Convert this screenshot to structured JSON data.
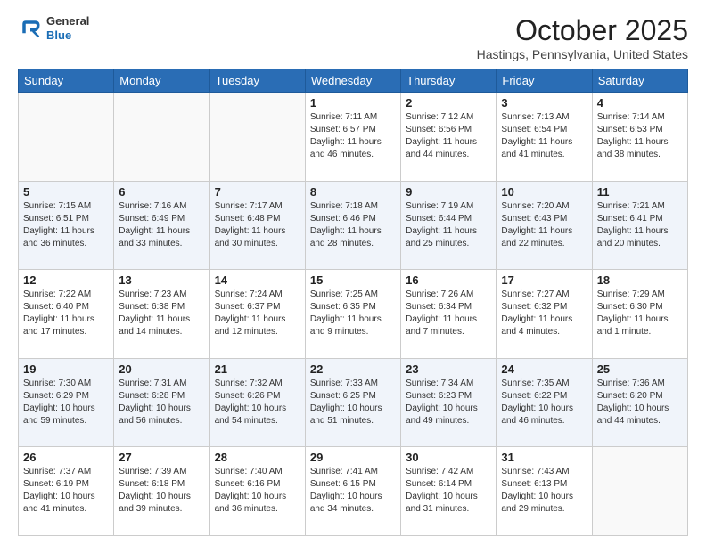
{
  "header": {
    "logo_line1": "General",
    "logo_line2": "Blue",
    "month": "October 2025",
    "location": "Hastings, Pennsylvania, United States"
  },
  "weekdays": [
    "Sunday",
    "Monday",
    "Tuesday",
    "Wednesday",
    "Thursday",
    "Friday",
    "Saturday"
  ],
  "weeks": [
    [
      {
        "day": "",
        "info": ""
      },
      {
        "day": "",
        "info": ""
      },
      {
        "day": "",
        "info": ""
      },
      {
        "day": "1",
        "info": "Sunrise: 7:11 AM\nSunset: 6:57 PM\nDaylight: 11 hours and 46 minutes."
      },
      {
        "day": "2",
        "info": "Sunrise: 7:12 AM\nSunset: 6:56 PM\nDaylight: 11 hours and 44 minutes."
      },
      {
        "day": "3",
        "info": "Sunrise: 7:13 AM\nSunset: 6:54 PM\nDaylight: 11 hours and 41 minutes."
      },
      {
        "day": "4",
        "info": "Sunrise: 7:14 AM\nSunset: 6:53 PM\nDaylight: 11 hours and 38 minutes."
      }
    ],
    [
      {
        "day": "5",
        "info": "Sunrise: 7:15 AM\nSunset: 6:51 PM\nDaylight: 11 hours and 36 minutes."
      },
      {
        "day": "6",
        "info": "Sunrise: 7:16 AM\nSunset: 6:49 PM\nDaylight: 11 hours and 33 minutes."
      },
      {
        "day": "7",
        "info": "Sunrise: 7:17 AM\nSunset: 6:48 PM\nDaylight: 11 hours and 30 minutes."
      },
      {
        "day": "8",
        "info": "Sunrise: 7:18 AM\nSunset: 6:46 PM\nDaylight: 11 hours and 28 minutes."
      },
      {
        "day": "9",
        "info": "Sunrise: 7:19 AM\nSunset: 6:44 PM\nDaylight: 11 hours and 25 minutes."
      },
      {
        "day": "10",
        "info": "Sunrise: 7:20 AM\nSunset: 6:43 PM\nDaylight: 11 hours and 22 minutes."
      },
      {
        "day": "11",
        "info": "Sunrise: 7:21 AM\nSunset: 6:41 PM\nDaylight: 11 hours and 20 minutes."
      }
    ],
    [
      {
        "day": "12",
        "info": "Sunrise: 7:22 AM\nSunset: 6:40 PM\nDaylight: 11 hours and 17 minutes."
      },
      {
        "day": "13",
        "info": "Sunrise: 7:23 AM\nSunset: 6:38 PM\nDaylight: 11 hours and 14 minutes."
      },
      {
        "day": "14",
        "info": "Sunrise: 7:24 AM\nSunset: 6:37 PM\nDaylight: 11 hours and 12 minutes."
      },
      {
        "day": "15",
        "info": "Sunrise: 7:25 AM\nSunset: 6:35 PM\nDaylight: 11 hours and 9 minutes."
      },
      {
        "day": "16",
        "info": "Sunrise: 7:26 AM\nSunset: 6:34 PM\nDaylight: 11 hours and 7 minutes."
      },
      {
        "day": "17",
        "info": "Sunrise: 7:27 AM\nSunset: 6:32 PM\nDaylight: 11 hours and 4 minutes."
      },
      {
        "day": "18",
        "info": "Sunrise: 7:29 AM\nSunset: 6:30 PM\nDaylight: 11 hours and 1 minute."
      }
    ],
    [
      {
        "day": "19",
        "info": "Sunrise: 7:30 AM\nSunset: 6:29 PM\nDaylight: 10 hours and 59 minutes."
      },
      {
        "day": "20",
        "info": "Sunrise: 7:31 AM\nSunset: 6:28 PM\nDaylight: 10 hours and 56 minutes."
      },
      {
        "day": "21",
        "info": "Sunrise: 7:32 AM\nSunset: 6:26 PM\nDaylight: 10 hours and 54 minutes."
      },
      {
        "day": "22",
        "info": "Sunrise: 7:33 AM\nSunset: 6:25 PM\nDaylight: 10 hours and 51 minutes."
      },
      {
        "day": "23",
        "info": "Sunrise: 7:34 AM\nSunset: 6:23 PM\nDaylight: 10 hours and 49 minutes."
      },
      {
        "day": "24",
        "info": "Sunrise: 7:35 AM\nSunset: 6:22 PM\nDaylight: 10 hours and 46 minutes."
      },
      {
        "day": "25",
        "info": "Sunrise: 7:36 AM\nSunset: 6:20 PM\nDaylight: 10 hours and 44 minutes."
      }
    ],
    [
      {
        "day": "26",
        "info": "Sunrise: 7:37 AM\nSunset: 6:19 PM\nDaylight: 10 hours and 41 minutes."
      },
      {
        "day": "27",
        "info": "Sunrise: 7:39 AM\nSunset: 6:18 PM\nDaylight: 10 hours and 39 minutes."
      },
      {
        "day": "28",
        "info": "Sunrise: 7:40 AM\nSunset: 6:16 PM\nDaylight: 10 hours and 36 minutes."
      },
      {
        "day": "29",
        "info": "Sunrise: 7:41 AM\nSunset: 6:15 PM\nDaylight: 10 hours and 34 minutes."
      },
      {
        "day": "30",
        "info": "Sunrise: 7:42 AM\nSunset: 6:14 PM\nDaylight: 10 hours and 31 minutes."
      },
      {
        "day": "31",
        "info": "Sunrise: 7:43 AM\nSunset: 6:13 PM\nDaylight: 10 hours and 29 minutes."
      },
      {
        "day": "",
        "info": ""
      }
    ]
  ]
}
